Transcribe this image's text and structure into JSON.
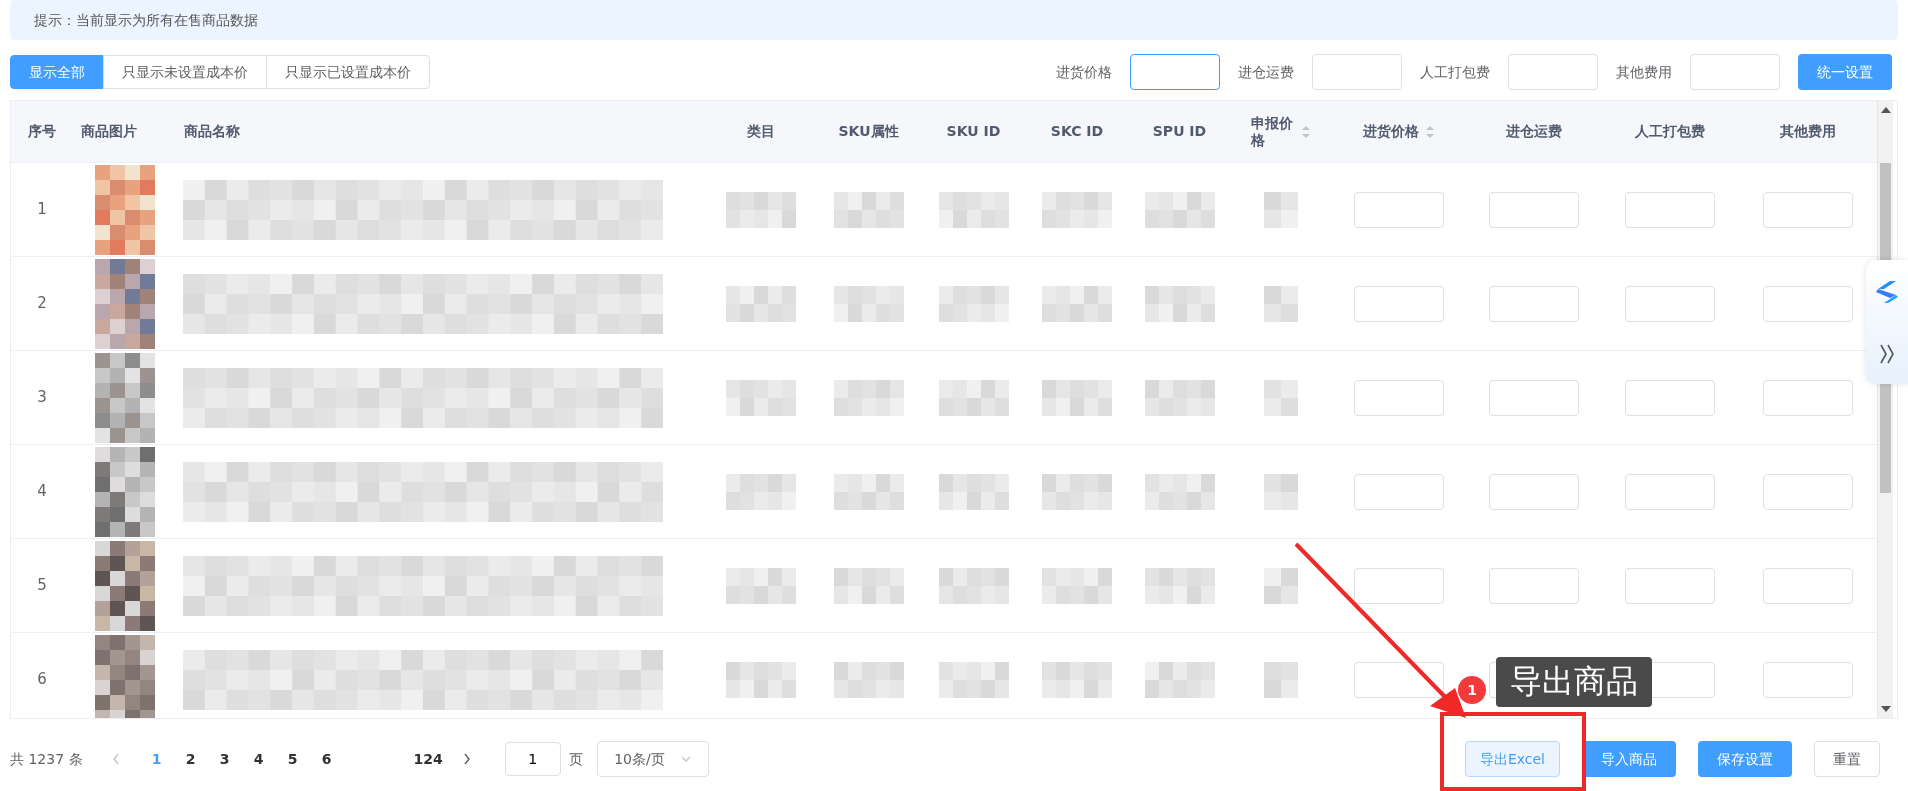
{
  "notice": "提示：当前显示为所有在售商品数据",
  "filter_tabs": [
    {
      "label": "显示全部",
      "selected": true
    },
    {
      "label": "只显示未设置成本价",
      "selected": false
    },
    {
      "label": "只显示已设置成本价",
      "selected": false
    }
  ],
  "cost_fields": [
    {
      "label": "进货价格",
      "focused": true
    },
    {
      "label": "进仓运费",
      "focused": false
    },
    {
      "label": "人工打包费",
      "focused": false
    },
    {
      "label": "其他费用",
      "focused": false
    }
  ],
  "apply_button": "统一设置",
  "table": {
    "columns": [
      {
        "label": "序号",
        "sortable": false
      },
      {
        "label": "商品图片",
        "sortable": false
      },
      {
        "label": "商品名称",
        "sortable": false
      },
      {
        "label": "类目",
        "sortable": false
      },
      {
        "label": "SKU属性",
        "sortable": false
      },
      {
        "label": "SKU ID",
        "sortable": false
      },
      {
        "label": "SKC ID",
        "sortable": false
      },
      {
        "label": "SPU ID",
        "sortable": false
      },
      {
        "label": "申报价格",
        "sortable": true
      },
      {
        "label": "进货价格",
        "sortable": true
      },
      {
        "label": "进仓运费",
        "sortable": false
      },
      {
        "label": "人工打包费",
        "sortable": false
      },
      {
        "label": "其他费用",
        "sortable": false
      }
    ],
    "rows": [
      {
        "index": "1"
      },
      {
        "index": "2"
      },
      {
        "index": "3"
      },
      {
        "index": "4"
      },
      {
        "index": "5"
      },
      {
        "index": "6"
      }
    ]
  },
  "pagination": {
    "total": "共 1237 条",
    "pages": [
      {
        "label": "1",
        "selected": true
      },
      {
        "label": "2",
        "selected": false
      },
      {
        "label": "3",
        "selected": false
      },
      {
        "label": "4",
        "selected": false
      },
      {
        "label": "5",
        "selected": false
      },
      {
        "label": "6",
        "selected": false
      },
      {
        "label": "124",
        "selected": false
      }
    ],
    "jump_value": "1",
    "jump_unit": "页",
    "page_size": "10条/页"
  },
  "actions": [
    {
      "label": "导出Excel",
      "kind": "outline"
    },
    {
      "label": "导入商品",
      "kind": "primary"
    },
    {
      "label": "保存设置",
      "kind": "primary"
    },
    {
      "label": "重置",
      "kind": "plain"
    }
  ],
  "annotation": {
    "badge": "1",
    "label": "导出商品"
  }
}
